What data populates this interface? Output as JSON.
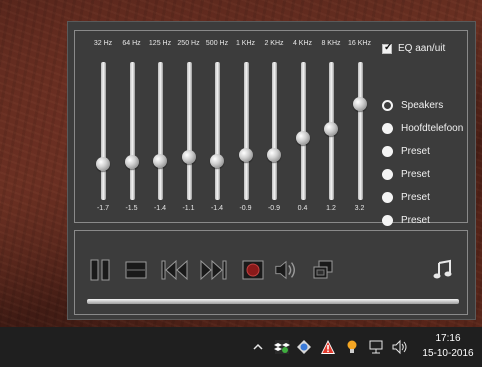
{
  "equalizer": {
    "bands": [
      {
        "freq": "32 Hz",
        "gain": "-1.7"
      },
      {
        "freq": "64 Hz",
        "gain": "-1.5"
      },
      {
        "freq": "125 Hz",
        "gain": "-1.4"
      },
      {
        "freq": "250 Hz",
        "gain": "-1.1"
      },
      {
        "freq": "500 Hz",
        "gain": "-1.4"
      },
      {
        "freq": "1 KHz",
        "gain": "-0.9"
      },
      {
        "freq": "2 KHz",
        "gain": "-0.9"
      },
      {
        "freq": "4 KHz",
        "gain": "0.4"
      },
      {
        "freq": "8 KHz",
        "gain": "1.2"
      },
      {
        "freq": "16 KHz",
        "gain": "3.2"
      }
    ],
    "toggle_label": "EQ aan/uit",
    "toggle_checked": true
  },
  "outputs": {
    "items": [
      {
        "label": "Speakers",
        "selected": true
      },
      {
        "label": "Hoofdtelefoon",
        "selected": false
      },
      {
        "label": "Preset",
        "selected": false
      },
      {
        "label": "Preset",
        "selected": false
      },
      {
        "label": "Preset",
        "selected": false
      },
      {
        "label": "Preset",
        "selected": false
      }
    ]
  },
  "player": {
    "buttons": [
      "pause-icon",
      "stop-icon",
      "previous-icon",
      "next-icon",
      "record-icon",
      "volume-icon",
      "window-icon",
      "music-note-icon"
    ],
    "progress": 0
  },
  "taskbar": {
    "time": "17:16",
    "date": "15-10-2016",
    "tray_icons": [
      "chevron-up-icon",
      "dropbox-icon",
      "app-icon",
      "warning-icon",
      "lightbulb-icon",
      "network-icon",
      "speaker-icon"
    ]
  },
  "colors": {
    "accent": "#f4f4f4",
    "panel": "#3c3c3c",
    "taskbar": "#1f1f1f"
  }
}
